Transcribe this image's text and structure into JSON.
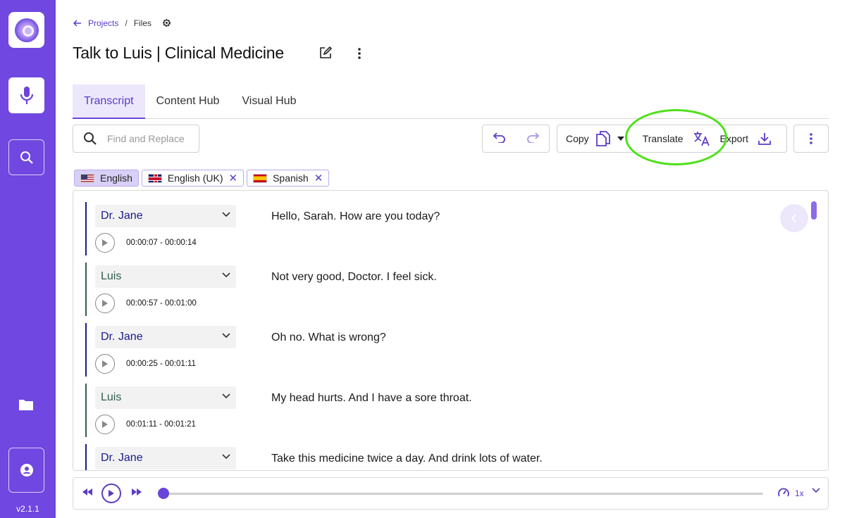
{
  "app": {
    "version": "v2.1.1"
  },
  "breadcrumb": {
    "back_label": "Projects",
    "separator": "/",
    "current": "Files"
  },
  "page": {
    "title": "Talk to Luis | Clinical Medicine"
  },
  "tabs": [
    {
      "label": "Transcript",
      "active": true
    },
    {
      "label": "Content Hub",
      "active": false
    },
    {
      "label": "Visual Hub",
      "active": false
    }
  ],
  "toolbar": {
    "search_placeholder": "Find and Replace",
    "copy_label": "Copy",
    "translate_label": "Translate",
    "export_label": "Export"
  },
  "languages": [
    {
      "label": "English",
      "flag": "us",
      "active": true,
      "removable": false
    },
    {
      "label": "English (UK)",
      "flag": "uk",
      "active": false,
      "removable": true
    },
    {
      "label": "Spanish",
      "flag": "es",
      "active": false,
      "removable": true
    }
  ],
  "segments": [
    {
      "speaker": "Dr. Jane",
      "time": "00:00:07 - 00:00:14",
      "text": "Hello, Sarah. How are you today?",
      "color": "#1a1a8c"
    },
    {
      "speaker": "Luis",
      "time": "00:00:57 - 00:01:00",
      "text": "Not very good, Doctor. I feel sick.",
      "color": "#2f5d50"
    },
    {
      "speaker": "Dr. Jane",
      "time": "00:00:25 - 00:01:11",
      "text": "Oh no. What is wrong?",
      "color": "#1a1a8c"
    },
    {
      "speaker": "Luis",
      "time": "00:01:11 - 00:01:21",
      "text": "My head hurts. And I have a sore throat.",
      "color": "#2f5d50"
    },
    {
      "speaker": "Dr. Jane",
      "time": "",
      "text": "Take this medicine twice a day. And drink lots of water.",
      "color": "#1a1a8c"
    }
  ],
  "player": {
    "speed": "1x",
    "progress": 0.0
  },
  "colors": {
    "sidebar": "#7047e0",
    "accent": "#5b3cc4",
    "highlight": "#4fe01a"
  }
}
